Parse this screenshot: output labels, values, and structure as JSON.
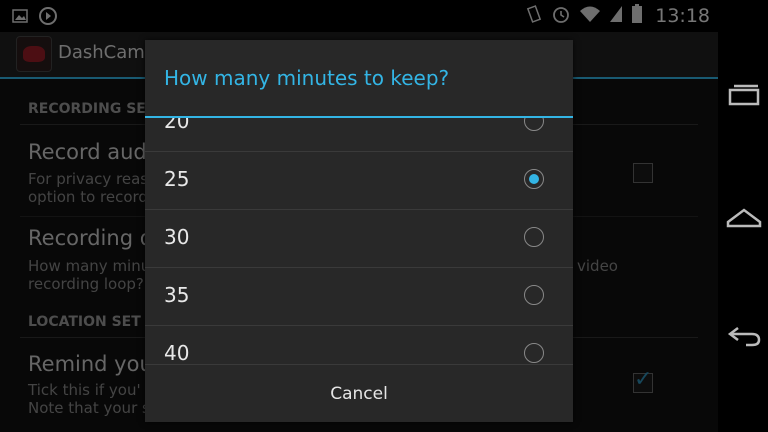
{
  "status_bar": {
    "time": "13:18",
    "left_icons": [
      "gallery-icon",
      "media-icon"
    ],
    "right_icons": [
      "vibrate-icon",
      "alarm-icon",
      "wifi-icon",
      "signal-icon",
      "battery-icon"
    ]
  },
  "action_bar": {
    "title": "DashCam"
  },
  "settings": {
    "recording_section": "RECORDING SE",
    "record_audio_title": "Record audi",
    "record_audio_summary_1": "For privacy reas",
    "record_audio_summary_2": "option to record",
    "recording_duration_title": "Recording d",
    "recording_duration_summary_1": "How many minu",
    "recording_duration_summary_1b": "video",
    "recording_duration_summary_2": "recording loop?",
    "location_section": "LOCATION SET",
    "remind_title": "Remind you",
    "remind_summary_1": "Tick this if you'",
    "remind_summary_2": "Note that your s"
  },
  "dialog": {
    "title": "How many minutes to keep?",
    "options": [
      {
        "label": "20",
        "selected": false
      },
      {
        "label": "25",
        "selected": true
      },
      {
        "label": "30",
        "selected": false
      },
      {
        "label": "35",
        "selected": false
      },
      {
        "label": "40",
        "selected": false
      }
    ],
    "cancel_label": "Cancel"
  },
  "colors": {
    "accent": "#33b5e5"
  }
}
